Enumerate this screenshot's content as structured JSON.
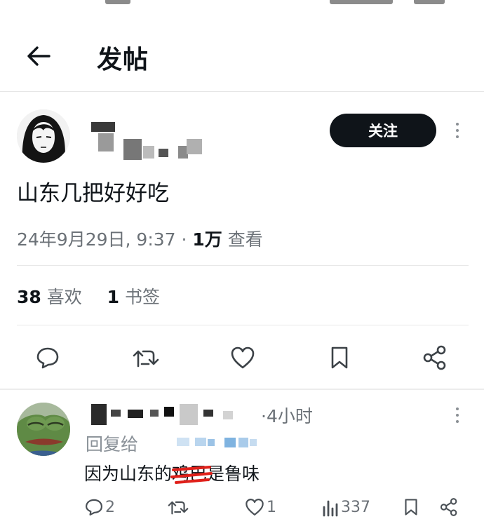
{
  "header": {
    "title": "发帖"
  },
  "post": {
    "follow_label": "关注",
    "text": "山东几把好好吃",
    "timestamp": "24年9月29日, 9:37 · ",
    "views_count": "1万",
    "views_label": " 查看",
    "likes_count": "38",
    "likes_label": " 喜欢",
    "bookmarks_count": "1",
    "bookmarks_label": " 书签"
  },
  "reply": {
    "time": "·4小时",
    "replying_to_label": "回复给",
    "text_before": "因为山东的",
    "text_struck": "鸡巴",
    "text_after": "是鲁味",
    "comments_count": "2",
    "likes_count": "1",
    "views_count": "337"
  },
  "colors": {
    "primary_text": "#0f1419",
    "secondary_text": "#6b7177",
    "follow_button": "#0f1419",
    "strike_mark": "#e0201a"
  }
}
